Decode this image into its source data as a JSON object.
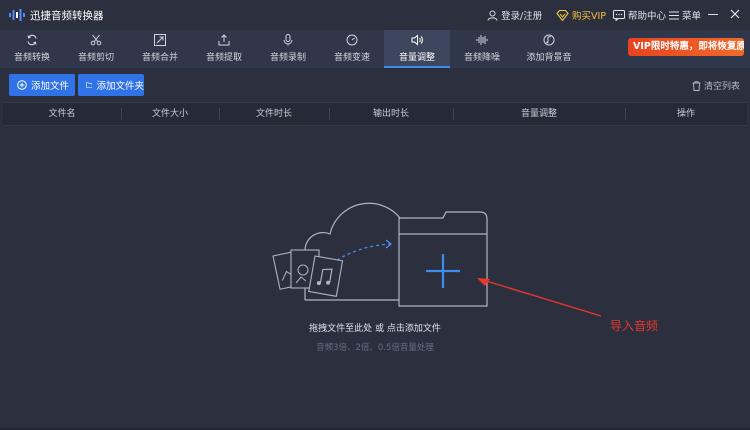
{
  "window": {
    "title": "迅捷音频转换器",
    "login_label": "登录/注册",
    "vip_label": "购买VIP",
    "help_label": "帮助中心",
    "menu_label": "菜单"
  },
  "tabs": [
    {
      "label": "音频转换",
      "icon": "refresh-icon"
    },
    {
      "label": "音频剪切",
      "icon": "scissors-icon"
    },
    {
      "label": "音频合并",
      "icon": "merge-icon"
    },
    {
      "label": "音频提取",
      "icon": "extract-icon"
    },
    {
      "label": "音频录制",
      "icon": "microphone-icon"
    },
    {
      "label": "音频变速",
      "icon": "speedometer-icon"
    },
    {
      "label": "音量调整",
      "icon": "speaker-icon",
      "active": true
    },
    {
      "label": "音频降噪",
      "icon": "waveform-icon"
    },
    {
      "label": "添加背景音",
      "icon": "music-disc-icon"
    }
  ],
  "promo": {
    "label": "VIP限时特惠，即将恢复原价"
  },
  "actions": {
    "add_file_label": "添加文件",
    "add_folder_label": "添加文件夹",
    "clear_list_label": "清空列表"
  },
  "table": {
    "columns": [
      "文件名",
      "文件大小",
      "文件时长",
      "输出时长",
      "音量调整",
      "操作"
    ]
  },
  "empty_state": {
    "hint": "拖拽文件至此处 或 点击添加文件",
    "subhint": "音频3倍、2倍、0.5倍音量处理"
  },
  "annotation": {
    "label": "导入音频",
    "color": "#e8372c"
  },
  "colors": {
    "accent": "#2f73e6",
    "background": "#2b2f3e",
    "vip": "#f3c43a"
  }
}
